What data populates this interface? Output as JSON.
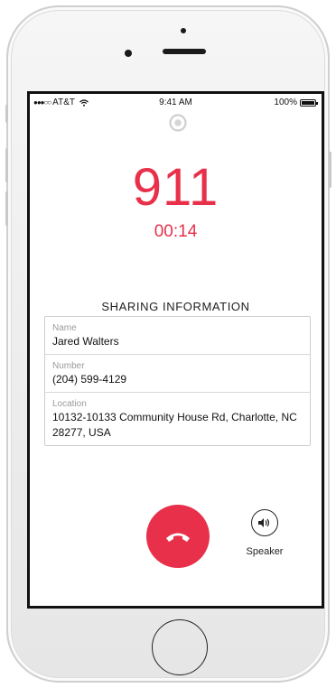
{
  "status_bar": {
    "carrier": "AT&T",
    "signal_icon": "signal-dots-icon",
    "wifi_icon": "wifi-icon",
    "time": "9:41 AM",
    "battery_percent": "100%",
    "battery_level": 1.0
  },
  "call": {
    "number": "911",
    "duration": "00:14"
  },
  "sharing": {
    "title": "SHARING INFORMATION",
    "rows": [
      {
        "label": "Name",
        "value": "Jared Walters"
      },
      {
        "label": "Number",
        "value": "(204) 599-4129"
      },
      {
        "label": "Location",
        "value": "10132-10133 Community House Rd, Charlotte, NC 28277, USA"
      }
    ]
  },
  "controls": {
    "end_call_icon": "phone-hangup-icon",
    "speaker_icon": "speaker-icon",
    "speaker_label": "Speaker"
  },
  "colors": {
    "accent": "#e8304a",
    "label_gray": "#9a9a9a"
  }
}
